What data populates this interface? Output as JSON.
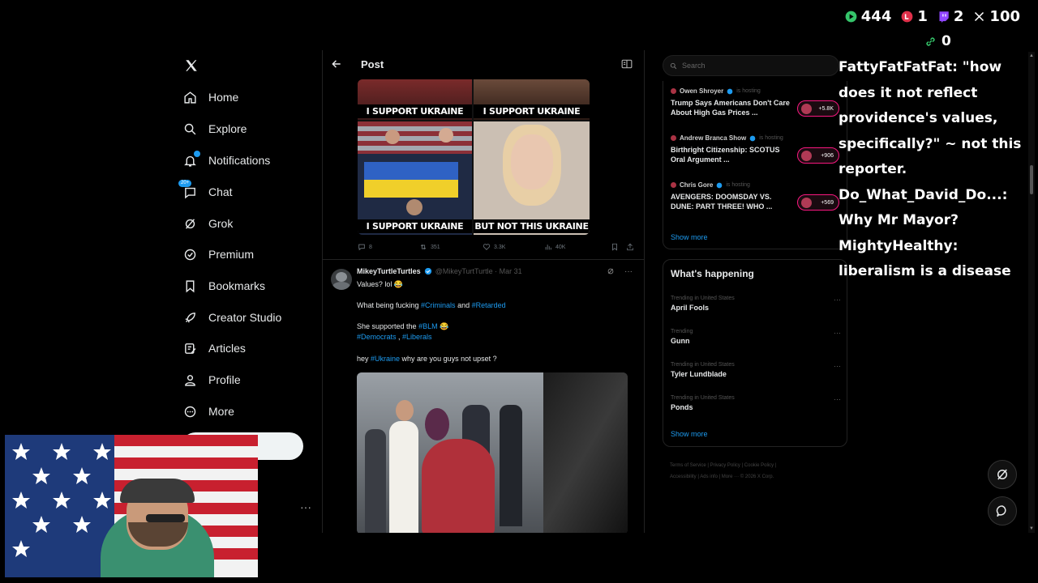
{
  "nav": {
    "items": [
      {
        "label": "Home",
        "icon": "home-icon"
      },
      {
        "label": "Explore",
        "icon": "search-icon"
      },
      {
        "label": "Notifications",
        "icon": "bell-icon"
      },
      {
        "label": "Chat",
        "icon": "chat-icon"
      },
      {
        "label": "Grok",
        "icon": "grok-icon"
      },
      {
        "label": "Premium",
        "icon": "premium-icon"
      },
      {
        "label": "Bookmarks",
        "icon": "bookmark-icon"
      },
      {
        "label": "Creator Studio",
        "icon": "rocket-icon"
      },
      {
        "label": "Articles",
        "icon": "articles-icon"
      },
      {
        "label": "Profile",
        "icon": "profile-icon"
      },
      {
        "label": "More",
        "icon": "more-circle-icon"
      }
    ],
    "chat_badge": "20+",
    "account_more": "···"
  },
  "post": {
    "title": "Post",
    "meme_captions": [
      "I SUPPORT UKRAINE",
      "I SUPPORT UKRAINE",
      "I SUPPORT UKRAINE",
      "BUT NOT THIS UKRAINE"
    ],
    "stats": [
      "8",
      "351",
      "3.3K",
      "40K"
    ]
  },
  "tweet2": {
    "name": "MikeyTurtleTurtles",
    "handle": "@MikeyTurtTurtle · Mar 31",
    "line1": "Values? lol 😂",
    "line2_prefix": "What being fucking ",
    "line2_tag1": "#Criminals",
    "line2_mid": " and ",
    "line2_tag2": "#Retarded",
    "line3_prefix": "She supported the ",
    "line3_tag": "#BLM",
    "line3_suffix": " 😂",
    "line4_tag1": "#Democrats",
    "line4_mid": " , ",
    "line4_tag2": "#Liberals",
    "line5_prefix": "hey ",
    "line5_tag": "#Ukraine",
    "line5_suffix": " why are you guys not upset ?",
    "more": "···"
  },
  "search": {
    "placeholder": "Search"
  },
  "spaces": {
    "items": [
      {
        "host": "Owen Shroyer",
        "status": "is hosting",
        "title": "Trump Says Americans Don't Care About High Gas Prices ...",
        "count": "+5.8K"
      },
      {
        "host": "Andrew Branca Show",
        "status": "is hosting",
        "title": "Birthright Citizenship: SCOTUS Oral Argument ...",
        "count": "+906"
      },
      {
        "host": "Chris Gore",
        "status": "is hosting",
        "title": "AVENGERS: DOOMSDAY VS. DUNE: PART THREE! WHO ...",
        "count": "+569"
      }
    ],
    "show_more": "Show more"
  },
  "happening": {
    "title": "What's happening",
    "trends": [
      {
        "context": "Trending in United States",
        "name": "April Fools"
      },
      {
        "context": "Trending",
        "name": "Gunn"
      },
      {
        "context": "Trending in United States",
        "name": "Tyler Lundblade"
      },
      {
        "context": "Trending in United States",
        "name": "Ponds"
      }
    ],
    "show_more": "Show more",
    "dots": "···"
  },
  "footer": {
    "line1": "Terms of Service  |  Privacy Policy  |  Cookie Policy  |",
    "line2": "Accessibility  |  Ads info  |  More ···  © 2026 X Corp."
  },
  "overlay": {
    "stats": [
      {
        "icon": "play-icon",
        "value": "444",
        "color": "#35c46a"
      },
      {
        "icon": "live-icon",
        "value": "1",
        "color": "#e0304a"
      },
      {
        "icon": "twitch-icon",
        "value": "2",
        "color": "#9146ff"
      },
      {
        "icon": "x-icon",
        "value": "100",
        "color": "#ffffff"
      }
    ],
    "link_count": "0",
    "chat": [
      "FattyFatFatFat: \"how does it not reflect providence's values, specifically?\" ~ not this reporter.",
      "Do_What_David_Do...: Why Mr Mayor?",
      "MightyHealthy: liberalism is a disease"
    ]
  },
  "colors": {
    "accent": "#1d9bf0",
    "background": "#000000"
  }
}
